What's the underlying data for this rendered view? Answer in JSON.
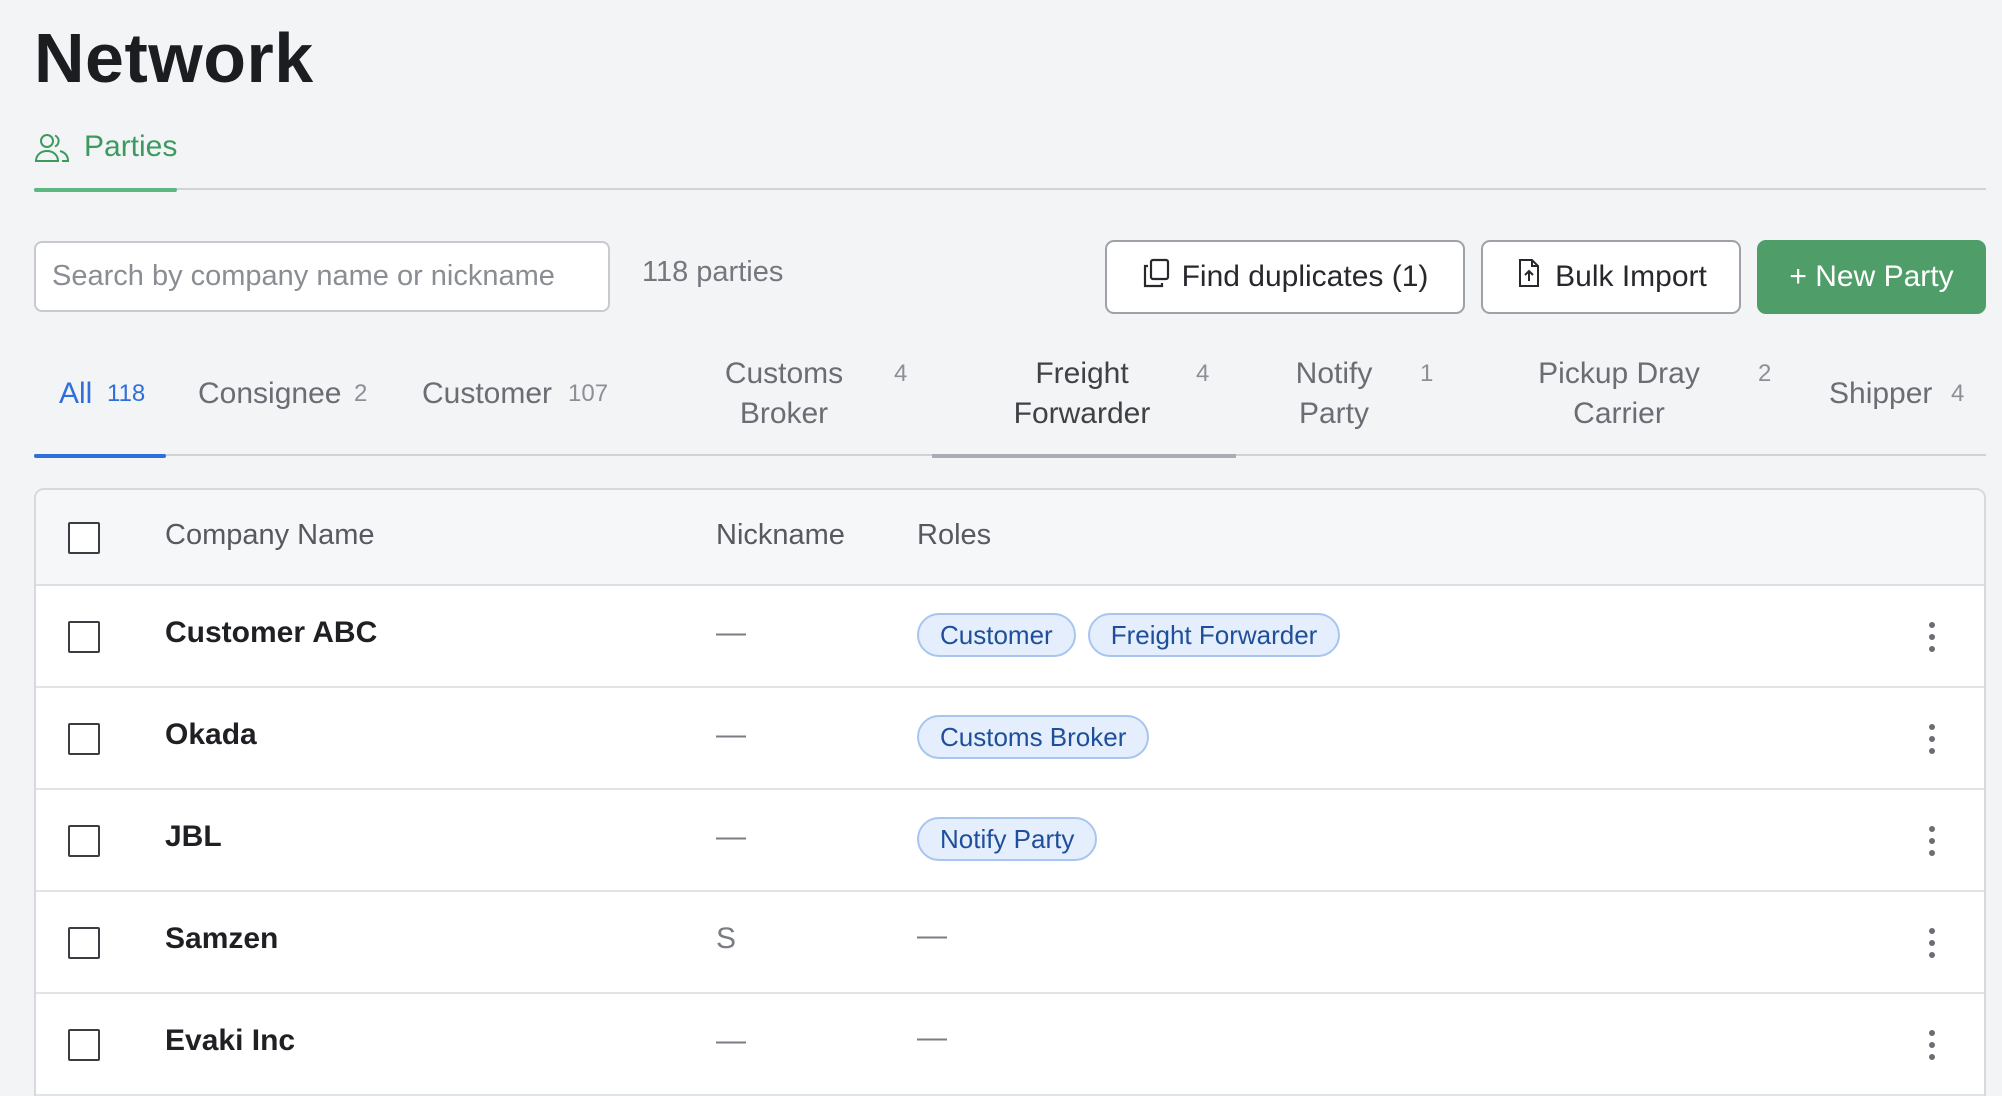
{
  "page": {
    "title": "Network"
  },
  "section_tab": {
    "label": "Parties",
    "icon": "users-icon"
  },
  "toolbar": {
    "search_placeholder": "Search by company name or nickname",
    "count_text": "118 parties",
    "find_duplicates_label": "Find duplicates (1)",
    "bulk_import_label": "Bulk Import",
    "new_party_label": "+ New Party"
  },
  "role_tabs": [
    {
      "label": "All",
      "count": "118"
    },
    {
      "label": "Consignee",
      "count": "2"
    },
    {
      "label": "Customer",
      "count": "107"
    },
    {
      "label_line1": "Customs",
      "label_line2": "Broker",
      "count": "4"
    },
    {
      "label_line1": "Freight",
      "label_line2": "Forwarder",
      "count": "4"
    },
    {
      "label_line1": "Notify",
      "label_line2": "Party",
      "count": "1"
    },
    {
      "label_line1": "Pickup Dray",
      "label_line2": "Carrier",
      "count": "2"
    },
    {
      "label": "Shipper",
      "count": "4"
    }
  ],
  "table": {
    "columns": {
      "company": "Company Name",
      "nickname": "Nickname",
      "roles": "Roles"
    },
    "rows": [
      {
        "company": "Customer ABC",
        "nickname": "—",
        "roles": [
          "Customer",
          "Freight Forwarder"
        ],
        "roles_empty": ""
      },
      {
        "company": "Okada",
        "nickname": "—",
        "roles": [
          "Customs Broker"
        ],
        "roles_empty": ""
      },
      {
        "company": "JBL",
        "nickname": "—",
        "roles": [
          "Notify Party"
        ],
        "roles_empty": ""
      },
      {
        "company": "Samzen",
        "nickname": "S",
        "roles": [],
        "roles_empty": "—"
      },
      {
        "company": "Evaki Inc",
        "nickname": "—",
        "roles": [],
        "roles_empty": "—"
      }
    ]
  },
  "colors": {
    "accent_green": "#4f9e6a",
    "active_tab_blue": "#2f6fdc",
    "chip_bg": "#e4eefc",
    "chip_border": "#a8c5ef"
  }
}
